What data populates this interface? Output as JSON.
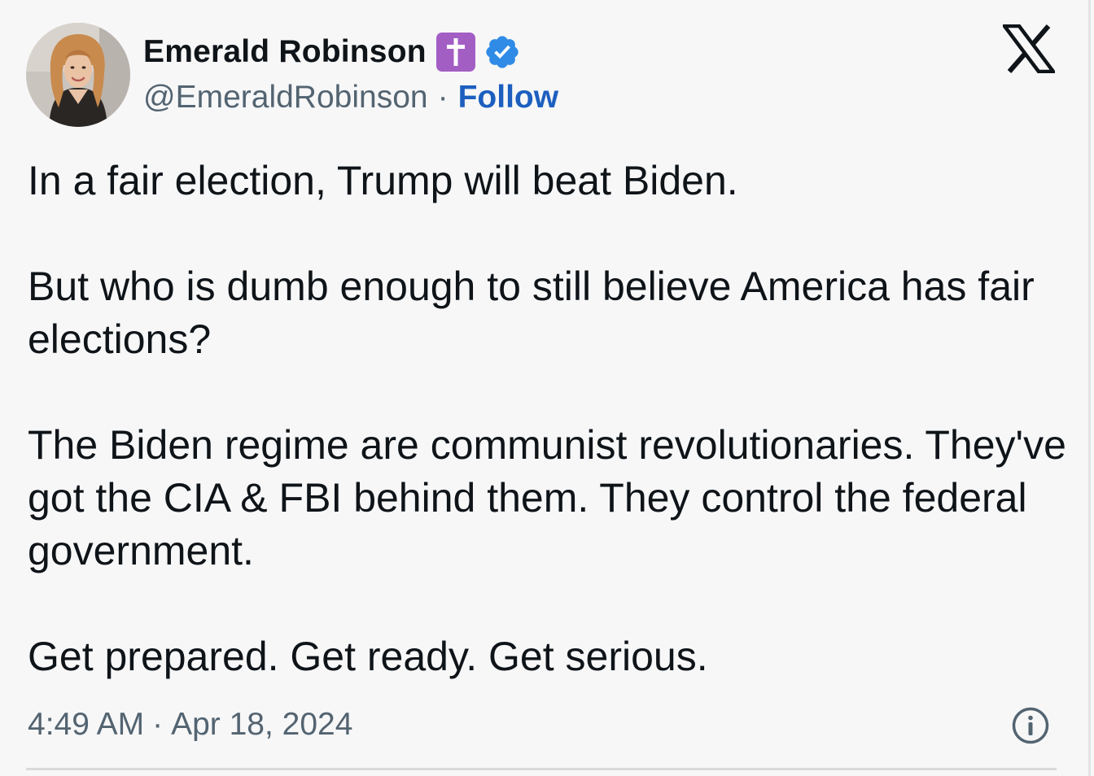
{
  "author": {
    "display_name": "Emerald Robinson",
    "handle": "@EmeraldRobinson",
    "separator": "·",
    "follow_label": "Follow",
    "avatar_alt": "avatar",
    "name_emoji": "latin-cross-emoji",
    "verified_icon": "verified-badge-icon"
  },
  "platform": {
    "logo_icon": "x-logo-icon"
  },
  "tweet": {
    "paragraphs": [
      "In a fair election, Trump will beat Biden.",
      "But who is dumb enough to still believe America has fair elections?",
      "The Biden regime are communist revolutionaries. They've got the CIA & FBI behind them. They control the federal government.",
      "Get prepared. Get ready. Get serious."
    ]
  },
  "meta": {
    "time": "4:49 AM",
    "separator": "·",
    "date": "Apr 18, 2024",
    "info_icon": "info-icon"
  },
  "colors": {
    "background": "#f7f7f8",
    "text": "#0f1419",
    "secondary_text": "#536471",
    "follow_link": "#1d5fbf",
    "verified_badge": "#2f8be6",
    "cross_emoji_bg": "#a35ec4"
  }
}
